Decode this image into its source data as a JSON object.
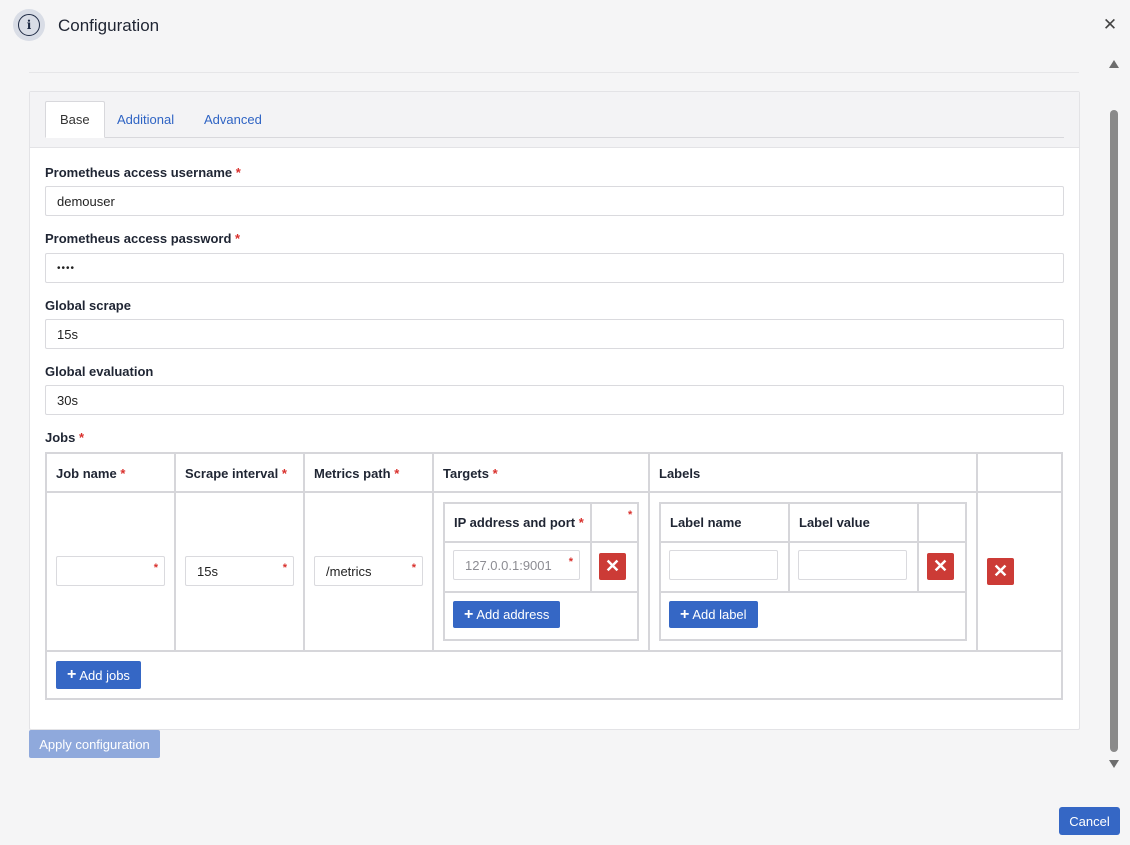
{
  "header": {
    "icon": "info-icon",
    "info_glyph": "i",
    "title": "Configuration",
    "close_glyph": "✕"
  },
  "tabs": [
    {
      "label": "Base",
      "active": true
    },
    {
      "label": "Additional",
      "active": false
    },
    {
      "label": "Advanced",
      "active": false
    }
  ],
  "required_mark": "*",
  "fields": {
    "username": {
      "label": "Prometheus access username",
      "value": "demouser",
      "required": true
    },
    "password": {
      "label": "Prometheus access password",
      "value": "••••",
      "required": true
    },
    "global_scrape": {
      "label": "Global scrape",
      "value": "15s"
    },
    "global_evaluation": {
      "label": "Global evaluation",
      "value": "30s"
    }
  },
  "jobs": {
    "label": "Jobs",
    "columns": [
      "Job name",
      "Scrape interval",
      "Metrics path",
      "Targets",
      "Labels"
    ],
    "row": {
      "job_name": "",
      "scrape_interval": "15s",
      "metrics_path": "/metrics"
    },
    "targets": {
      "column": "IP address and port",
      "address_placeholder": "127.0.0.1:9001",
      "add_label": "Add address"
    },
    "labels": {
      "columns": [
        "Label name",
        "Label value"
      ],
      "name": "",
      "value": "",
      "add_label": "Add label"
    },
    "add_jobs_label": "Add jobs",
    "delete_glyph": "✕",
    "plus_glyph": "+"
  },
  "buttons": {
    "apply": "Apply configuration",
    "cancel": "Cancel"
  },
  "colors": {
    "primary": "#3567c5",
    "danger": "#cc3b36",
    "required": "#d9302c",
    "disabled_primary": "#8fa9dc"
  }
}
